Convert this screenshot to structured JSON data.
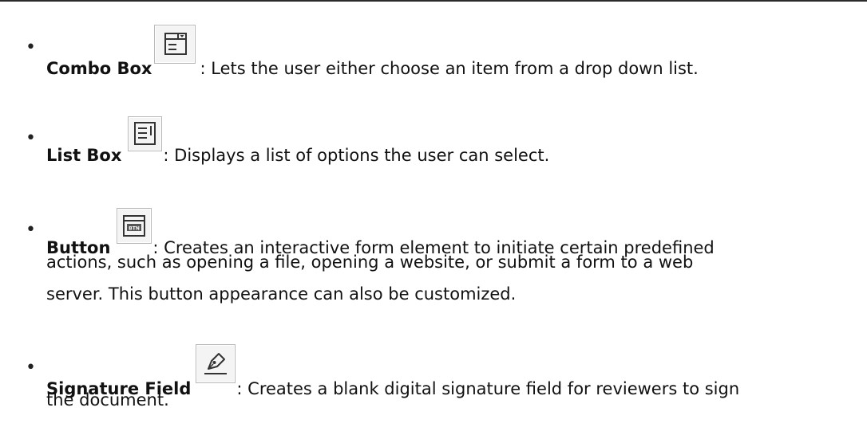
{
  "bullet_glyph": "•",
  "items": [
    {
      "term": "Combo Box",
      "icon": "combo-box-icon",
      "lines": [
        ": Lets the user either choose an item from a drop down list."
      ]
    },
    {
      "term": "List Box",
      "icon": "list-box-icon",
      "lines": [
        ": Displays a list of options the user can select."
      ]
    },
    {
      "term": "Button",
      "icon": "button-field-icon",
      "icon_text": "BTN",
      "lines": [
        ": Creates an interactive form element to initiate certain predefined",
        "actions, such as opening a file, opening a website, or submit a form to a web",
        "server. This button appearance can also be customized."
      ]
    },
    {
      "term": "Signature Field",
      "icon": "signature-field-icon",
      "lines": [
        ": Creates a blank digital signature field for reviewers to sign",
        "the document."
      ]
    }
  ]
}
